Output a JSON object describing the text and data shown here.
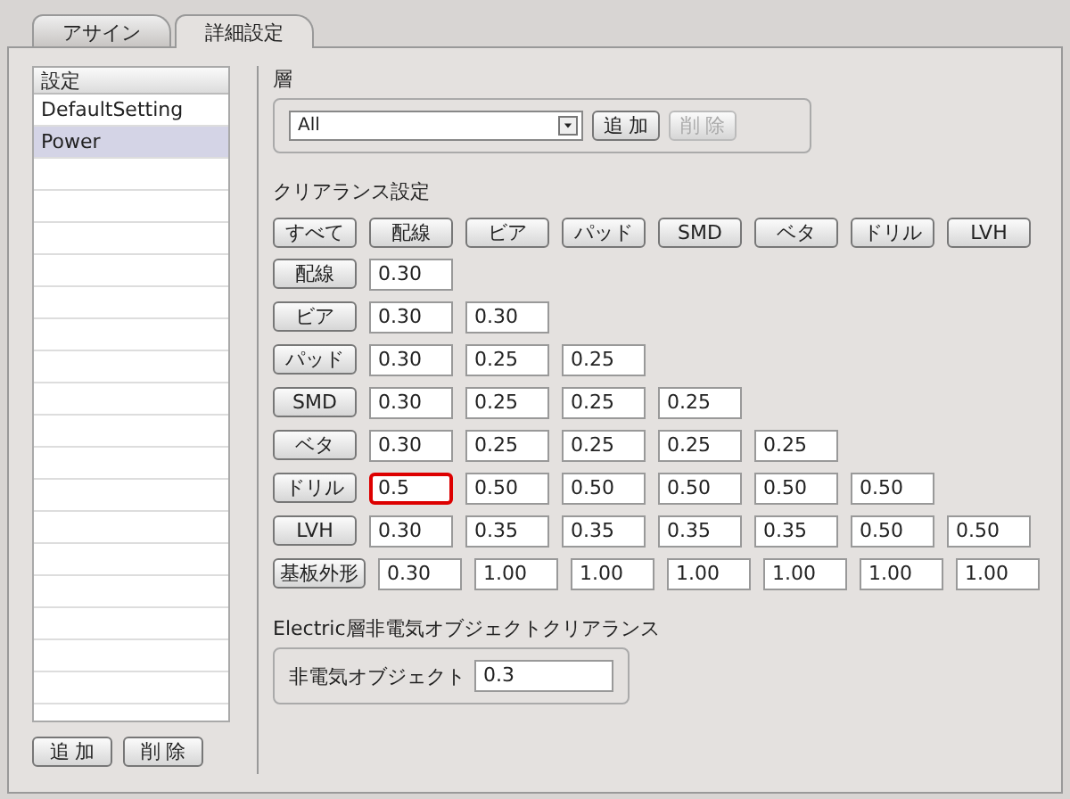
{
  "tabs": [
    {
      "label": "アサイン",
      "selected": false
    },
    {
      "label": "詳細設定",
      "selected": true
    }
  ],
  "settings_list": {
    "header": "設定",
    "items": [
      {
        "label": "DefaultSetting",
        "selected": false
      },
      {
        "label": "Power",
        "selected": true
      }
    ]
  },
  "list_buttons": [
    {
      "label": "追 加",
      "disabled": false
    },
    {
      "label": "削 除",
      "disabled": false
    }
  ],
  "layer": {
    "label": "層",
    "value": "All",
    "buttons": [
      {
        "label": "追 加",
        "disabled": false
      },
      {
        "label": "削 除",
        "disabled": true
      }
    ]
  },
  "clearance": {
    "label": "クリアランス設定",
    "header_buttons": [
      "すべて",
      "配線",
      "ビア",
      "パッド",
      "SMD",
      "ベタ",
      "ドリル",
      "LVH"
    ],
    "rows": [
      {
        "label": "配線",
        "cells": [
          {
            "value": "0.30",
            "focused": false
          }
        ]
      },
      {
        "label": "ビア",
        "cells": [
          {
            "value": "0.30",
            "focused": false
          },
          {
            "value": "0.30",
            "focused": false
          }
        ]
      },
      {
        "label": "パッド",
        "cells": [
          {
            "value": "0.30",
            "focused": false
          },
          {
            "value": "0.25",
            "focused": false
          },
          {
            "value": "0.25",
            "focused": false
          }
        ]
      },
      {
        "label": "SMD",
        "cells": [
          {
            "value": "0.30",
            "focused": false
          },
          {
            "value": "0.25",
            "focused": false
          },
          {
            "value": "0.25",
            "focused": false
          },
          {
            "value": "0.25",
            "focused": false
          }
        ]
      },
      {
        "label": "ベタ",
        "cells": [
          {
            "value": "0.30",
            "focused": false
          },
          {
            "value": "0.25",
            "focused": false
          },
          {
            "value": "0.25",
            "focused": false
          },
          {
            "value": "0.25",
            "focused": false
          },
          {
            "value": "0.25",
            "focused": false
          }
        ]
      },
      {
        "label": "ドリル",
        "cells": [
          {
            "value": "0.5",
            "focused": true
          },
          {
            "value": "0.50",
            "focused": false
          },
          {
            "value": "0.50",
            "focused": false
          },
          {
            "value": "0.50",
            "focused": false
          },
          {
            "value": "0.50",
            "focused": false
          },
          {
            "value": "0.50",
            "focused": false
          }
        ]
      },
      {
        "label": "LVH",
        "cells": [
          {
            "value": "0.30",
            "focused": false
          },
          {
            "value": "0.35",
            "focused": false
          },
          {
            "value": "0.35",
            "focused": false
          },
          {
            "value": "0.35",
            "focused": false
          },
          {
            "value": "0.35",
            "focused": false
          },
          {
            "value": "0.50",
            "focused": false
          },
          {
            "value": "0.50",
            "focused": false
          }
        ]
      },
      {
        "label": "基板外形",
        "cells": [
          {
            "value": "0.30",
            "focused": false
          },
          {
            "value": "1.00",
            "focused": false
          },
          {
            "value": "1.00",
            "focused": false
          },
          {
            "value": "1.00",
            "focused": false
          },
          {
            "value": "1.00",
            "focused": false
          },
          {
            "value": "1.00",
            "focused": false
          },
          {
            "value": "1.00",
            "focused": false
          }
        ]
      }
    ]
  },
  "non_electric": {
    "label": "Electric層非電気オブジェクトクリアランス",
    "field_label": "非電気オブジェクト",
    "value": "0.3"
  }
}
